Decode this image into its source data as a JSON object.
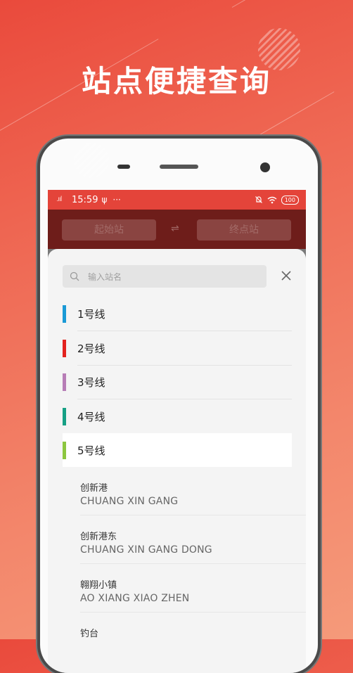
{
  "headline": "站点便捷查询",
  "status_bar": {
    "signal": ".ııl",
    "time": "15:59",
    "usb_icon": "ψ",
    "dots": "···",
    "battery": "100"
  },
  "top_bar": {
    "start_placeholder": "起始站",
    "end_placeholder": "终点站",
    "swap_symbol": "⇌"
  },
  "sheet": {
    "search_placeholder": "输入站名",
    "lines": [
      {
        "name": "1号线",
        "color": "#1a9ad6"
      },
      {
        "name": "2号线",
        "color": "#e3231f"
      },
      {
        "name": "3号线",
        "color": "#b77db6"
      },
      {
        "name": "4号线",
        "color": "#16a085"
      },
      {
        "name": "5号线",
        "color": "#8cc63f"
      }
    ],
    "stations": [
      {
        "name": "创新港",
        "pinyin": "CHUANG XIN GANG"
      },
      {
        "name": "创新港东",
        "pinyin": "CHUANG XIN GANG DONG"
      },
      {
        "name": "翱翔小镇",
        "pinyin": "AO XIANG XIAO ZHEN"
      },
      {
        "name": "钓台",
        "pinyin": ""
      }
    ]
  }
}
